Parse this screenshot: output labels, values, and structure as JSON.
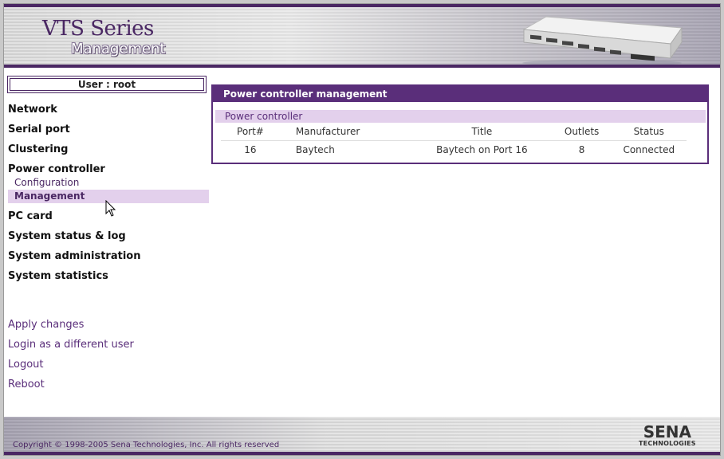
{
  "header": {
    "title": "VTS Series",
    "subtitle": "Management"
  },
  "sidebar": {
    "user_label": "User : root",
    "items": [
      {
        "label": "Network"
      },
      {
        "label": "Serial port"
      },
      {
        "label": "Clustering"
      },
      {
        "label": "Power controller",
        "children": [
          {
            "label": "Configuration"
          },
          {
            "label": "Management",
            "active": true
          }
        ]
      },
      {
        "label": "PC card"
      },
      {
        "label": "System status & log"
      },
      {
        "label": "System administration"
      },
      {
        "label": "System statistics"
      }
    ],
    "actions": [
      {
        "label": "Apply changes"
      },
      {
        "label": "Login as a different user"
      },
      {
        "label": "Logout"
      },
      {
        "label": "Reboot"
      }
    ]
  },
  "main": {
    "panel_title": "Power controller management",
    "section_title": "Power controller",
    "table": {
      "columns": [
        "Port#",
        "Manufacturer",
        "Title",
        "Outlets",
        "Status"
      ],
      "rows": [
        {
          "port": "16",
          "manufacturer": "Baytech",
          "title": "Baytech on Port 16",
          "outlets": "8",
          "status": "Connected"
        }
      ]
    }
  },
  "footer": {
    "copyright": "Copyright © 1998-2005 Sena Technologies, Inc. All rights reserved",
    "brand": "SENA",
    "brand_sub": "TECHNOLOGIES"
  },
  "colors": {
    "accent": "#5a2e7a",
    "dark_accent": "#4a2763",
    "highlight": "#e3d0ec"
  },
  "icons": [
    "device-image",
    "mouse-cursor-icon",
    "sena-logo"
  ]
}
